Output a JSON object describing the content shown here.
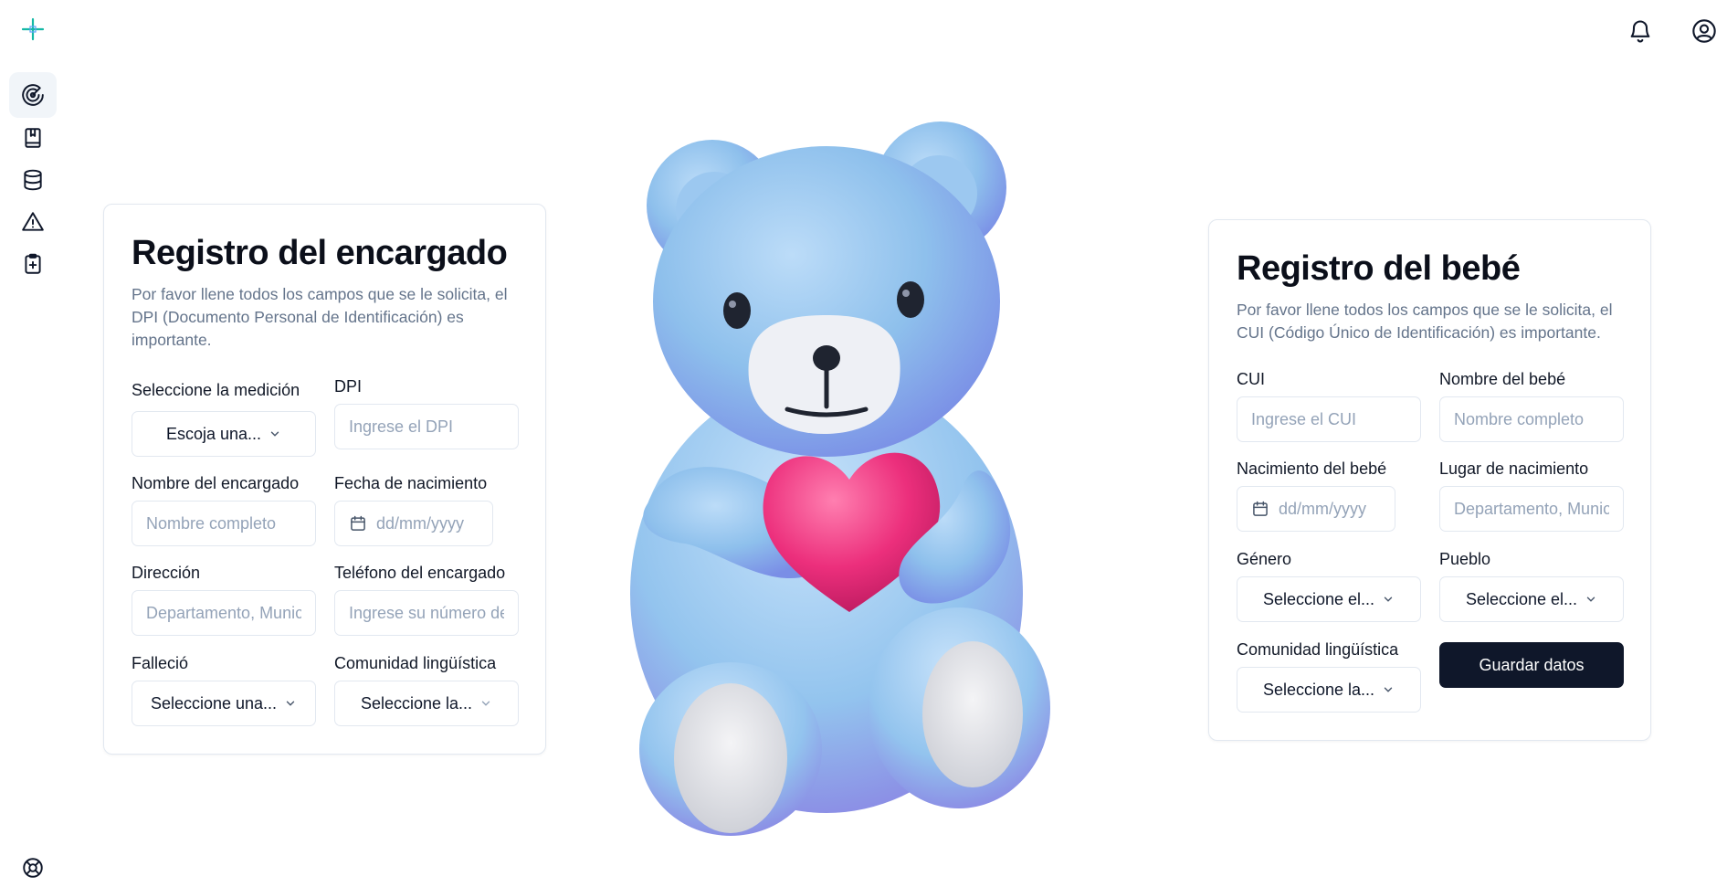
{
  "sidebar": {
    "logo": "plus-logo",
    "items": [
      {
        "icon": "radar-icon",
        "active": true
      },
      {
        "icon": "bookmark-book-icon",
        "active": false
      },
      {
        "icon": "database-icon",
        "active": false
      },
      {
        "icon": "warning-triangle-icon",
        "active": false
      },
      {
        "icon": "clipboard-plus-icon",
        "active": false
      }
    ],
    "bottom_icon": "life-buoy-icon"
  },
  "header": {
    "icons": [
      "bell-icon",
      "user-circle-icon"
    ]
  },
  "guardian_form": {
    "title": "Registro del encargado",
    "description": "Por favor llene todos los campos que se le solicita, el DPI (Documento Personal de Identificación) es importante.",
    "measurement": {
      "label": "Seleccione la medición",
      "value": "Escoja una..."
    },
    "dpi": {
      "label": "DPI",
      "placeholder": "Ingrese el DPI"
    },
    "name": {
      "label": "Nombre del encargado",
      "placeholder": "Nombre completo"
    },
    "birth_date": {
      "label": "Fecha de nacimiento",
      "placeholder": "dd/mm/yyyy"
    },
    "address": {
      "label": "Dirección",
      "placeholder": "Departamento, Municipio"
    },
    "phone": {
      "label": "Teléfono del encargado",
      "placeholder": "Ingrese su número de teléfono"
    },
    "deceased": {
      "label": "Falleció",
      "value": "Seleccione una..."
    },
    "language": {
      "label": "Comunidad lingüística",
      "value": "Seleccione la..."
    }
  },
  "baby_form": {
    "title": "Registro del bebé",
    "description": "Por favor llene todos los campos que se le solicita, el CUI (Código Único de Identificación) es importante.",
    "cui": {
      "label": "CUI",
      "placeholder": "Ingrese el CUI"
    },
    "name": {
      "label": "Nombre del bebé",
      "placeholder": "Nombre completo"
    },
    "birth_date": {
      "label": "Nacimiento del bebé",
      "placeholder": "dd/mm/yyyy"
    },
    "birth_place": {
      "label": "Lugar de nacimiento",
      "placeholder": "Departamento, Municipio"
    },
    "gender": {
      "label": "Género",
      "value": "Seleccione el..."
    },
    "people": {
      "label": "Pueblo",
      "value": "Seleccione el..."
    },
    "language": {
      "label": "Comunidad lingüística",
      "value": "Seleccione la..."
    },
    "submit_label": "Guardar datos"
  },
  "colors": {
    "primary": "#0f172a",
    "muted_text": "#64748b",
    "border": "#e2e8f0",
    "bear_blue": "#8ec0ec",
    "heart_pink": "#ec2f7c",
    "logo_teal": "#14b8a6"
  }
}
